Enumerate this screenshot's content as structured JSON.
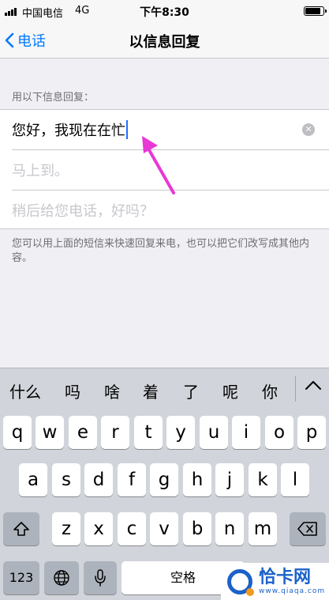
{
  "status_bar": {
    "carrier": "中国电信",
    "network": "4G",
    "time": "下午8:30",
    "battery": 0.85
  },
  "nav": {
    "back_label": "电话",
    "title": "以信息回复"
  },
  "section_header": "用以下信息回复：",
  "replies": [
    {
      "value": "您好，我现在在忙",
      "placeholder": ""
    },
    {
      "value": "",
      "placeholder": "马上到。"
    },
    {
      "value": "",
      "placeholder": "稍后给您电话，好吗？"
    }
  ],
  "footer_note": "您可以用上面的短信来快速回复来电，也可以把它们改写成其他内容。",
  "keyboard": {
    "suggestions": [
      "什么",
      "吗",
      "啥",
      "着",
      "了",
      "呢",
      "你"
    ],
    "row1": [
      "q",
      "w",
      "e",
      "r",
      "t",
      "y",
      "u",
      "i",
      "o",
      "p"
    ],
    "row2": [
      "a",
      "s",
      "d",
      "f",
      "g",
      "h",
      "j",
      "k",
      "l"
    ],
    "row3": [
      "z",
      "x",
      "c",
      "v",
      "b",
      "n",
      "m"
    ],
    "numbers_key": "123",
    "space_key": "空格"
  },
  "watermark": {
    "brand": "恰卡网",
    "url": "www.qiaqa.com"
  },
  "colors": {
    "accent": "#007aff",
    "arrow": "#e838d6"
  }
}
